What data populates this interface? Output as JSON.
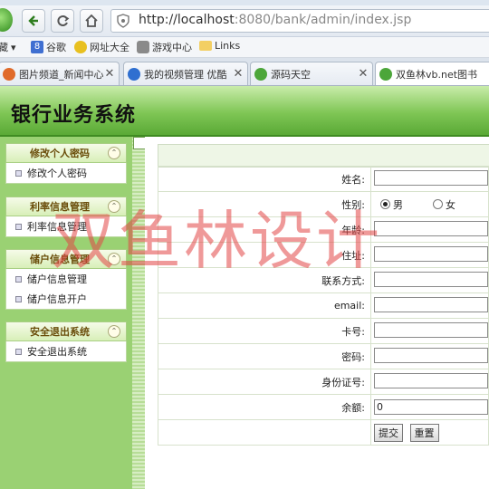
{
  "browser": {
    "url_host": "http://localhost",
    "url_rest": ":8080/bank/admin/index.jsp",
    "favorites": [
      {
        "label": "藏",
        "icon": "favorites-icon"
      },
      {
        "label": "谷歌",
        "icon": "google-icon"
      },
      {
        "label": "网址大全",
        "icon": "site-directory-icon"
      },
      {
        "label": "游戏中心",
        "icon": "game-center-icon"
      },
      {
        "label": "Links",
        "icon": "folder-icon"
      }
    ],
    "tabs": [
      {
        "label": "图片频道_新闻中心",
        "icon": "page-icon"
      },
      {
        "label": "我的视频管理 优酷",
        "icon": "video-icon"
      },
      {
        "label": "源码天空",
        "icon": "page-icon"
      },
      {
        "label": "双鱼林vb.net图书",
        "icon": "page-icon"
      }
    ]
  },
  "app": {
    "title": "银行业务系统",
    "sidebar": [
      {
        "group": "修改个人密码",
        "items": [
          "修改个人密码"
        ]
      },
      {
        "group": "利率信息管理",
        "items": [
          "利率信息管理"
        ]
      },
      {
        "group": "储户信息管理",
        "items": [
          "储户信息管理",
          "储户信息开户"
        ]
      },
      {
        "group": "安全退出系统",
        "items": [
          "安全退出系统"
        ]
      }
    ],
    "form": {
      "name_label": "姓名:",
      "gender_label": "性别:",
      "gender_male": "男",
      "gender_female": "女",
      "age_label": "年龄:",
      "address_label": "住址:",
      "contact_label": "联系方式:",
      "email_label": "email:",
      "card_label": "卡号:",
      "password_label": "密码:",
      "id_label": "身份证号:",
      "balance_label": "余额:",
      "balance_value": "0",
      "submit_label": "提交",
      "reset_label": "重置"
    }
  },
  "watermark": "双鱼林设计"
}
